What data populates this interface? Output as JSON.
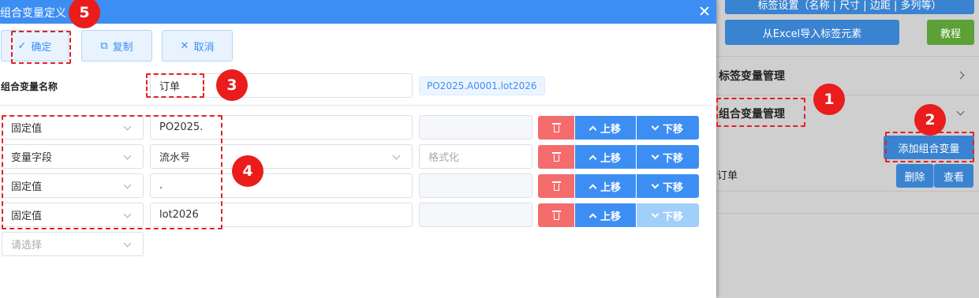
{
  "background": {
    "top_button": "标签设置（名称 | 尺寸 | 边距 | 多列等）",
    "import_button": "从Excel导入标签元素",
    "tutorial_button": "教程",
    "label_var_section": "标签变量管理",
    "combo_var_section": "组合变量管理",
    "add_combo_button": "添加组合变量",
    "combo_item": "订单",
    "delete_button": "删除",
    "view_button": "查看"
  },
  "dialog": {
    "title": "组合变量定义",
    "toolbar": {
      "confirm": "确定",
      "copy": "复制",
      "cancel": "取消"
    },
    "name_label": "组合变量名称",
    "name_value": "订单",
    "preview": "PO2025.A0001.lot2026",
    "rows": [
      {
        "type": "固定值",
        "value": "PO2025.",
        "format": "",
        "format_placeholder": "",
        "up": "上移",
        "down": "下移",
        "value_dropdown": false,
        "up_disabled": false,
        "down_disabled": false
      },
      {
        "type": "变量字段",
        "value": "流水号",
        "format": "",
        "format_placeholder": "格式化",
        "up": "上移",
        "down": "下移",
        "value_dropdown": true,
        "up_disabled": false,
        "down_disabled": false
      },
      {
        "type": "固定值",
        "value": ".",
        "format": "",
        "format_placeholder": "",
        "up": "上移",
        "down": "下移",
        "value_dropdown": false,
        "up_disabled": false,
        "down_disabled": false
      },
      {
        "type": "固定值",
        "value": "lot2026",
        "format": "",
        "format_placeholder": "",
        "up": "上移",
        "down": "下移",
        "value_dropdown": false,
        "up_disabled": false,
        "down_disabled": true
      }
    ],
    "new_row_placeholder": "请选择"
  },
  "annotations": [
    "1",
    "2",
    "3",
    "4",
    "5"
  ],
  "colors": {
    "primary": "#3d8ef3",
    "danger": "#f56c6c",
    "annotation": "#ea1c1c",
    "tutorial": "#5ca037"
  }
}
